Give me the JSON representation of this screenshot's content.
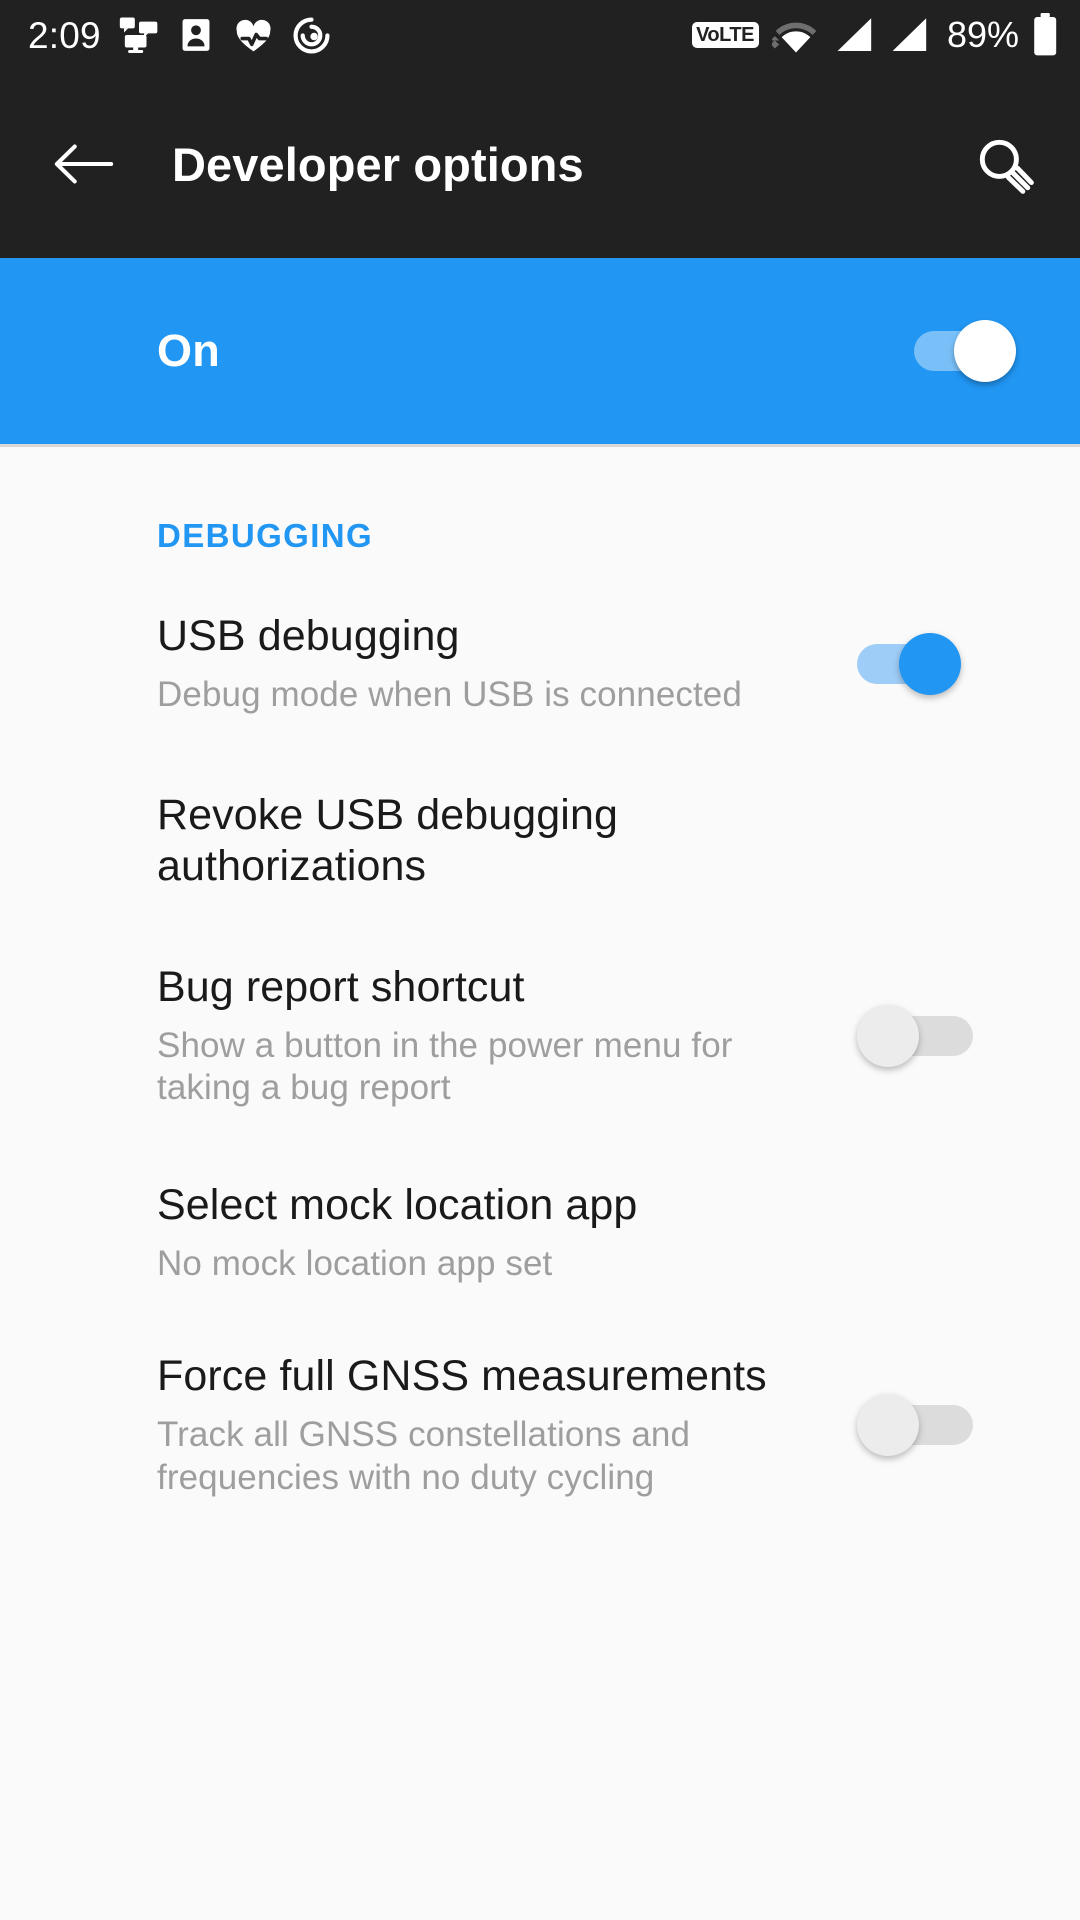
{
  "status_bar": {
    "clock": "2:09",
    "notification_icons": [
      "chat-monitor-icon",
      "contact-card-icon",
      "heart-check-icon",
      "spiral-target-icon"
    ],
    "volte_label": "VoLTE",
    "wifi_icon": "wifi-icon",
    "signal_icons": [
      "cellular-signal-icon",
      "cellular-signal-icon"
    ],
    "battery_percent": "89%",
    "battery_icon": "battery-full-icon"
  },
  "app_bar": {
    "back_icon": "back-arrow-icon",
    "title": "Developer options",
    "search_icon": "search-icon"
  },
  "master_switch": {
    "label": "On",
    "state": "on"
  },
  "sections": [
    {
      "header": "DEBUGGING",
      "rows": [
        {
          "title": "USB debugging",
          "subtitle": "Debug mode when USB is connected",
          "control": "switch",
          "state": "on"
        },
        {
          "title": "Revoke USB debugging authorizations",
          "subtitle": "",
          "control": "none",
          "state": ""
        },
        {
          "title": "Bug report shortcut",
          "subtitle": "Show a button in the power menu for taking a bug report",
          "control": "switch",
          "state": "off"
        },
        {
          "title": "Select mock location app",
          "subtitle": "No mock location app set",
          "control": "none",
          "state": ""
        },
        {
          "title": "Force full GNSS measurements",
          "subtitle": "Track all GNSS constellations and frequencies with no duty cycling",
          "control": "switch",
          "state": "off"
        }
      ]
    }
  ],
  "colors": {
    "accent": "#2196f3",
    "app_bar_bg": "#212121",
    "page_bg": "#fafafa",
    "title_text": "#1a1a1a",
    "subtitle_text": "#9e9e9e"
  }
}
